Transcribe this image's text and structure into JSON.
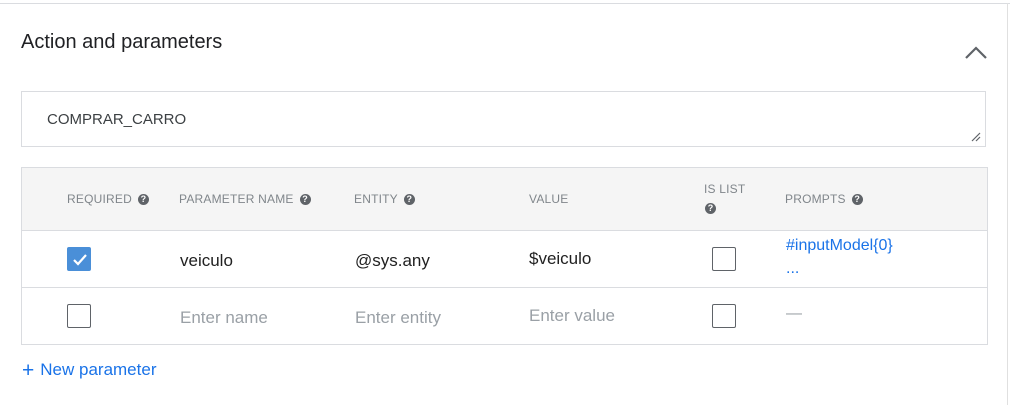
{
  "section": {
    "title": "Action and parameters"
  },
  "action": {
    "value": "COMPRAR_CARRO"
  },
  "table": {
    "headers": {
      "required": "REQUIRED",
      "parameter_name": "PARAMETER NAME",
      "entity": "ENTITY",
      "value": "VALUE",
      "is_list_1": "IS LIST",
      "prompts": "PROMPTS"
    },
    "help_glyph": "?",
    "rows": [
      {
        "required": true,
        "name": "veiculo",
        "entity": "@sys.any",
        "value": "$veiculo",
        "is_list": false,
        "prompt": "#inputModel{0}",
        "prompt_more": "..."
      }
    ],
    "new_row": {
      "required": false,
      "name_placeholder": "Enter name",
      "entity_placeholder": "Enter entity",
      "value_placeholder": "Enter value",
      "is_list": false,
      "prompt": "—"
    }
  },
  "new_parameter": {
    "plus": "+",
    "label": "New parameter"
  },
  "colors": {
    "accent": "#1a73e8",
    "checkbox_checked": "#4a8fd8",
    "header_bg": "#f5f5f5",
    "border": "#dadce0"
  },
  "icons": {
    "collapse": "chevron-up-icon",
    "help": "help-circle-icon",
    "check": "check-icon",
    "resize": "resize-grip-icon"
  }
}
